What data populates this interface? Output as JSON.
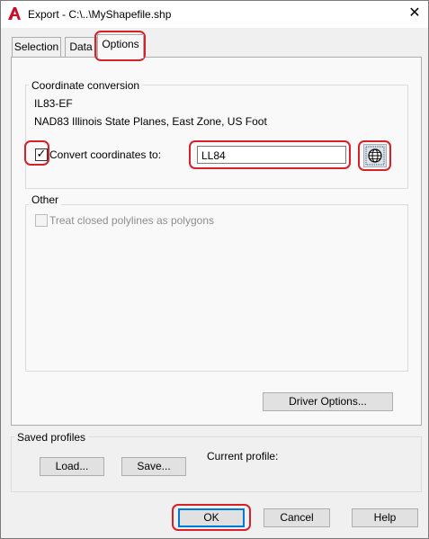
{
  "window": {
    "title": "Export - C:\\..\\MyShapefile.shp",
    "close_glyph": "✕"
  },
  "tabs": [
    {
      "label": "Selection"
    },
    {
      "label": "Data"
    },
    {
      "label": "Options"
    }
  ],
  "coordinate_conversion": {
    "group_label": "Coordinate conversion",
    "source_code": "IL83-EF",
    "source_description": "NAD83 Illinois State Planes, East Zone, US Foot",
    "convert_label": "Convert coordinates to:",
    "convert_checked": true,
    "target_value": "LL84",
    "globe_button_icon": "globe-icon"
  },
  "other": {
    "group_label": "Other",
    "polygons_label": "Treat closed polylines as polygons",
    "polygons_checked": false
  },
  "driver_options_label": "Driver Options...",
  "saved_profiles": {
    "group_label": "Saved profiles",
    "load_label": "Load...",
    "save_label": "Save...",
    "current_profile_label": "Current profile:"
  },
  "footer": {
    "ok_label": "OK",
    "cancel_label": "Cancel",
    "help_label": "Help"
  },
  "colors": {
    "highlight": "#d5222a",
    "default_button_border": "#0078d7",
    "autocad_red": "#c8102e"
  }
}
